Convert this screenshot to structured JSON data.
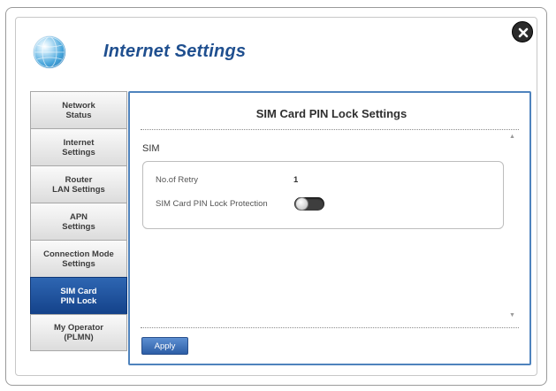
{
  "window": {
    "title": "Internet Settings",
    "icon": "globe-icon",
    "close_icon": "close-icon"
  },
  "sidebar": {
    "items": [
      {
        "label": "Network\nStatus",
        "active": false
      },
      {
        "label": "Internet\nSettings",
        "active": false
      },
      {
        "label": "Router\nLAN Settings",
        "active": false
      },
      {
        "label": "APN\nSettings",
        "active": false
      },
      {
        "label": "Connection Mode\nSettings",
        "active": false
      },
      {
        "label": "SIM Card\nPIN Lock",
        "active": true
      },
      {
        "label": "My Operator\n(PLMN)",
        "active": false
      }
    ]
  },
  "panel": {
    "title": "SIM Card PIN Lock Settings",
    "section_label": "SIM",
    "fields": {
      "retry_label": "No.of Retry",
      "retry_value": "1",
      "pin_lock_label": "SIM Card PIN Lock Protection",
      "pin_lock_enabled": false
    },
    "apply_label": "Apply"
  },
  "colors": {
    "accent": "#1f4f8f",
    "active_nav": "#1d4f9c",
    "panel_border": "#4f83bd"
  }
}
